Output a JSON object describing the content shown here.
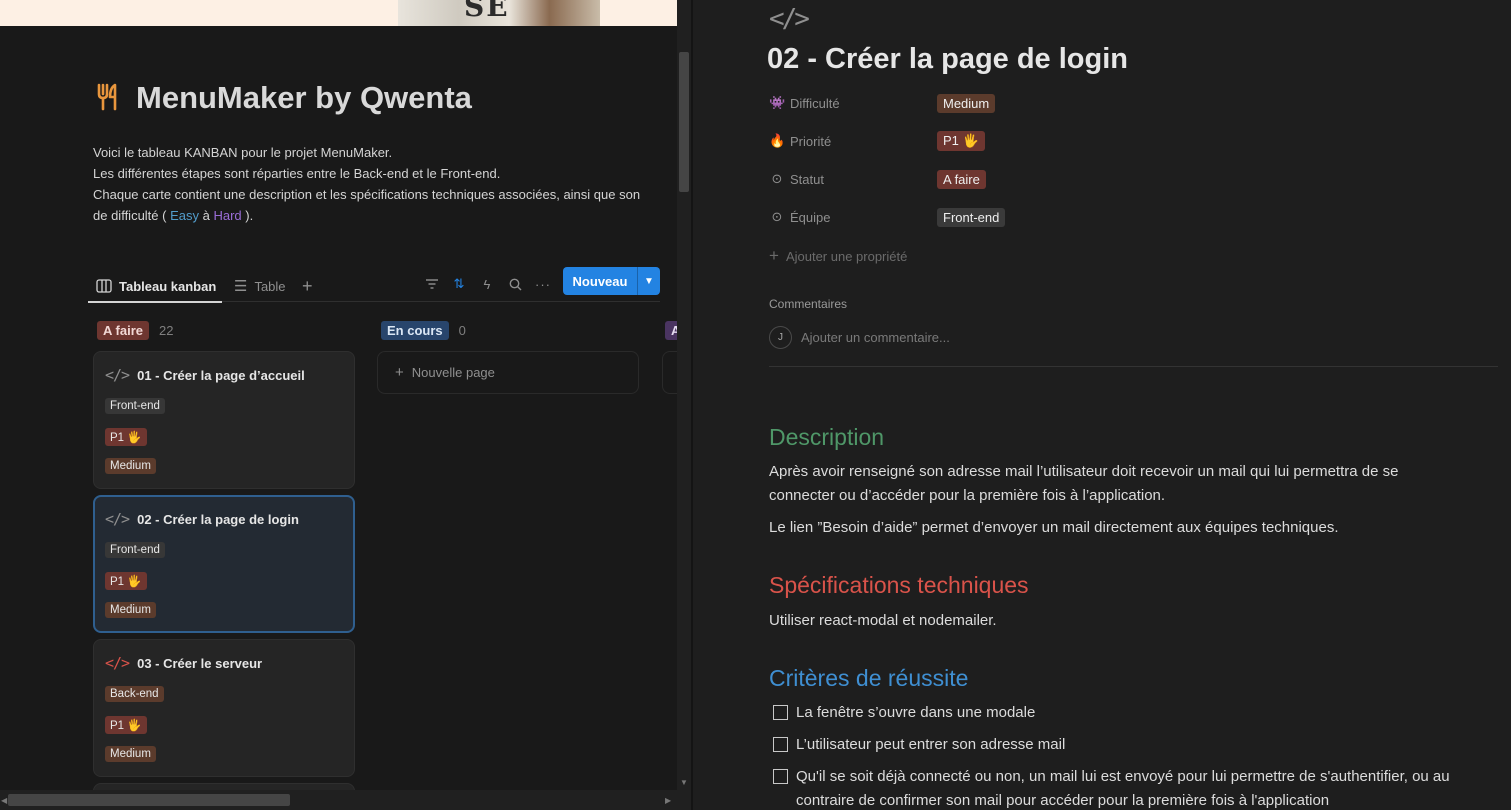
{
  "left": {
    "cover_text": "SE",
    "page_title": "MenuMaker by Qwenta",
    "intro": {
      "line1": "Voici le tableau KANBAN pour le projet MenuMaker.",
      "line2": "Les différentes étapes sont réparties entre le Back-end et le Front-end.",
      "line3": "Chaque carte contient une description et les spécifications techniques associées, ainsi que son",
      "line4_prefix": "de difficulté ( ",
      "easy": "Easy",
      "middle": " à ",
      "hard": "Hard",
      "line4_suffix": " )."
    },
    "views": {
      "kanban_label": "Tableau kanban",
      "table_label": "Table",
      "add": "+",
      "new_button": "Nouveau"
    },
    "groups": [
      {
        "label": "A faire",
        "count": "22"
      },
      {
        "label": "En cours",
        "count": "0"
      },
      {
        "label": "A",
        "count": ""
      }
    ],
    "cards": [
      {
        "title": "01 - Créer la page d’accueil",
        "team": "Front-end",
        "priority": "P1 🖐",
        "difficulty": "Medium"
      },
      {
        "title": "02 - Créer la page de login",
        "team": "Front-end",
        "priority": "P1 🖐",
        "difficulty": "Medium"
      },
      {
        "title": "03 - Créer le serveur",
        "team": "Back-end",
        "priority": "P1 🖐",
        "difficulty": "Medium"
      }
    ],
    "new_page": "Nouvelle page"
  },
  "right": {
    "title": "02 - Créer la page de login",
    "props": [
      {
        "name": "Difficulté",
        "value": "Medium"
      },
      {
        "name": "Priorité",
        "value": "P1 🖐"
      },
      {
        "name": "Statut",
        "value": "A faire"
      },
      {
        "name": "Équipe",
        "value": "Front-end"
      }
    ],
    "add_property": "Ajouter une propriété",
    "comments_heading": "Commentaires",
    "avatar_initial": "J",
    "comment_placeholder": "Ajouter un commentaire...",
    "description_heading": "Description",
    "description_p1_line1": "Après avoir renseigné son adresse mail l’utilisateur doit recevoir un mail qui lui permettra de se",
    "description_p1_line2": "connecter ou d’accéder pour la première fois à l’application.",
    "description_p2": "Le lien ”Besoin d’aide” permet d’envoyer un mail directement aux équipes techniques.",
    "spec_heading": "Spécifications techniques",
    "spec_text": "Utiliser react-modal et nodemailer.",
    "criteria_heading": "Critères de réussite",
    "criteria": [
      {
        "line1": "La fenêtre s’ouvre dans une modale",
        "line2": ""
      },
      {
        "line1": "L’utilisateur peut entrer son adresse mail",
        "line2": ""
      },
      {
        "line1": "Qu'il se soit déjà connecté ou non, un mail lui est envoyé pour lui permettre de s'authentifier, ou au",
        "line2": "contraire de confirmer son mail pour accéder pour la première fois à l'application"
      }
    ]
  },
  "colors": {
    "accent": "#2383e2",
    "description_heading": "#4f9768",
    "spec_heading": "#d9534a",
    "criteria_heading": "#3f8fd2"
  }
}
